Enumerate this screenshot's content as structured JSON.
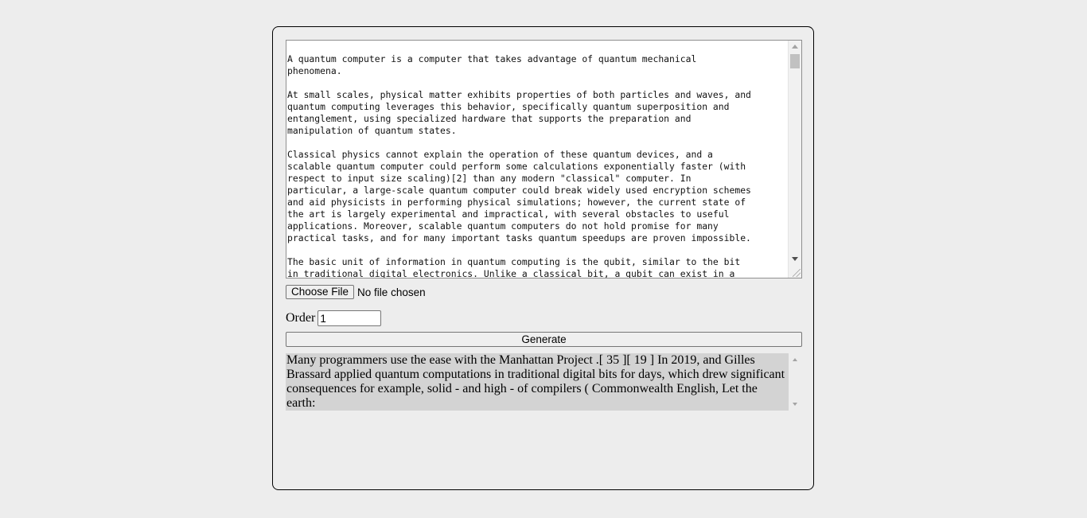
{
  "source": {
    "text": "A quantum computer is a computer that takes advantage of quantum mechanical\nphenomena.\n\nAt small scales, physical matter exhibits properties of both particles and waves, and\nquantum computing leverages this behavior, specifically quantum superposition and\nentanglement, using specialized hardware that supports the preparation and\nmanipulation of quantum states.\n\nClassical physics cannot explain the operation of these quantum devices, and a\nscalable quantum computer could perform some calculations exponentially faster (with\nrespect to input size scaling)[2] than any modern \"classical\" computer. In\nparticular, a large-scale quantum computer could break widely used encryption schemes\nand aid physicists in performing physical simulations; however, the current state of\nthe art is largely experimental and impractical, with several obstacles to useful\napplications. Moreover, scalable quantum computers do not hold promise for many\npractical tasks, and for many important tasks quantum speedups are proven impossible.\n\nThe basic unit of information in quantum computing is the qubit, similar to the bit\nin traditional digital electronics. Unlike a classical bit, a qubit can exist in a"
  },
  "file_input": {
    "button_label": "Choose File",
    "status": "No file chosen"
  },
  "order": {
    "label": "Order",
    "value": "1"
  },
  "generate": {
    "label": "Generate"
  },
  "output": {
    "text": "Many programmers use the ease with the Manhattan Project .[ 35 ][ 19 ] In 2019, and Gilles Brassard applied quantum computations in traditional digital bits for days, which drew significant consequences for example, solid - and high - of compilers ( Commonwealth English, Let the earth:"
  }
}
